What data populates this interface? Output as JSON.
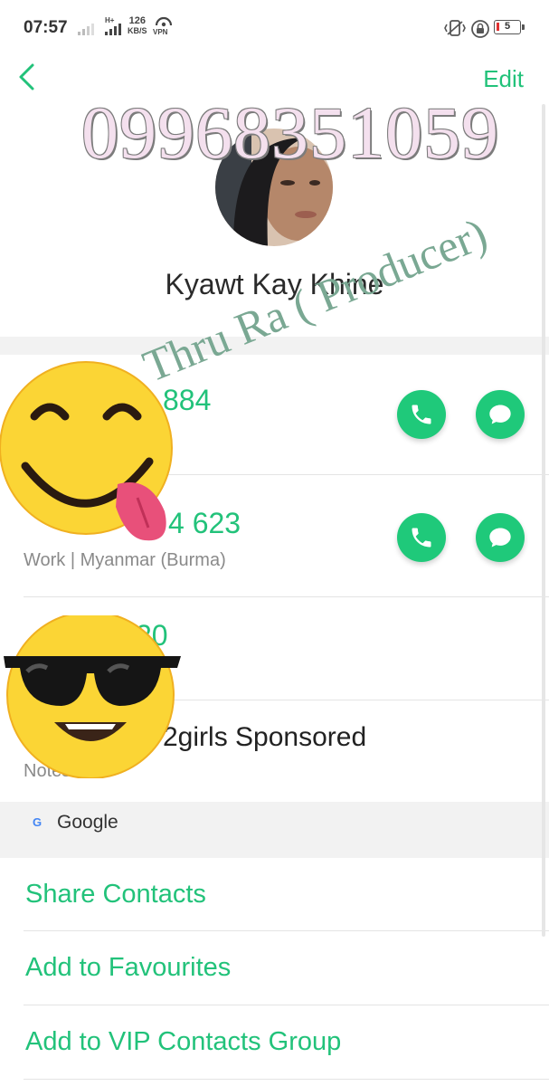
{
  "status_bar": {
    "time": "07:57",
    "network": "H+",
    "speed_value": "126",
    "speed_unit": "KB/S",
    "vpn_label": "VPN",
    "battery_level": "5",
    "icons": [
      "signal-icon",
      "vpn-icon",
      "vibrate-icon",
      "lock-rotation-icon",
      "battery-icon"
    ]
  },
  "header": {
    "back_icon": "chevron-left-icon",
    "edit_label": "Edit"
  },
  "watermarks": {
    "phone": "09968351059",
    "producer": "Thru Ra ( Producer)"
  },
  "contact": {
    "name": "Kyawt Kay Khine"
  },
  "numbers": [
    {
      "value": "884",
      "label": ""
    },
    {
      "value": "4 623",
      "label": "Work | Myanmar (Burma)"
    },
    {
      "value": "20",
      "label": ""
    }
  ],
  "note": {
    "text": "2girls Sponsored",
    "label": "Notes"
  },
  "account": {
    "logo": "G",
    "label": "Google"
  },
  "actions": {
    "share": "Share Contacts",
    "favourites": "Add to Favourites",
    "vip": "Add to VIP Contacts Group"
  },
  "colors": {
    "accent": "#22c27a",
    "call_button": "#1fc97a",
    "band": "#f2f2f2"
  }
}
